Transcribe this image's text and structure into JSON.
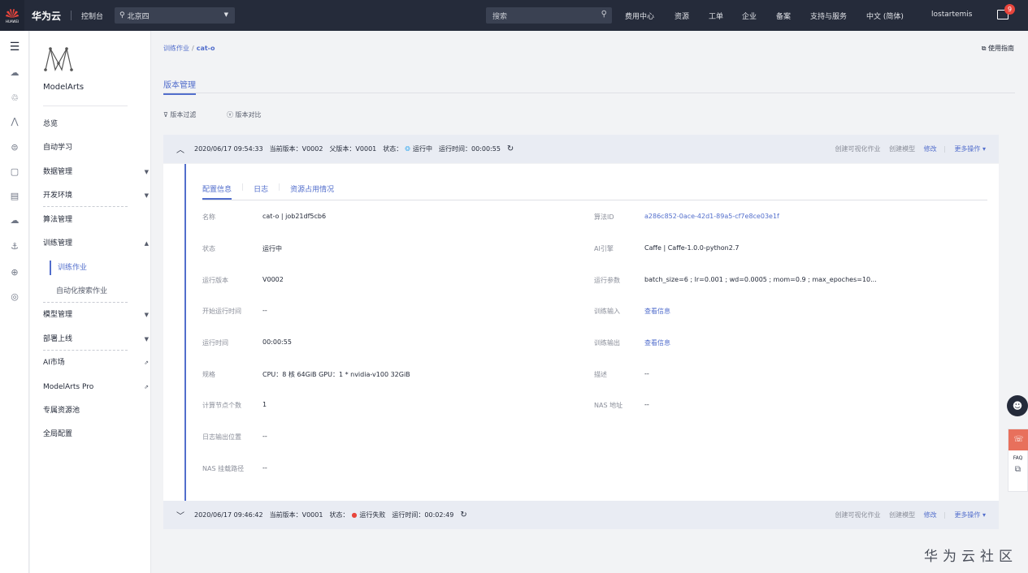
{
  "topbar": {
    "logo_text": "HUAWEI",
    "brand": "华为云",
    "console": "控制台",
    "region": "北京四",
    "search_placeholder": "搜索",
    "nav": [
      "费用中心",
      "资源",
      "工单",
      "企业",
      "备案",
      "支持与服务",
      "中文 (简体)",
      "lostartemis"
    ],
    "mail_badge": "9"
  },
  "sidebar": {
    "product": "ModelArts",
    "items": [
      {
        "label": "总览"
      },
      {
        "label": "自动学习"
      },
      {
        "label": "数据管理",
        "arrow": "▼"
      },
      {
        "label": "开发环境",
        "arrow": "▼"
      },
      {
        "label": "算法管理"
      },
      {
        "label": "训练管理",
        "arrow": "▲"
      },
      {
        "label": "训练作业",
        "sub": true,
        "active": true
      },
      {
        "label": "自动化搜索作业",
        "sub": true
      },
      {
        "label": "模型管理",
        "arrow": "▼"
      },
      {
        "label": "部署上线",
        "arrow": "▼"
      },
      {
        "label": "AI市场",
        "arrow": "⇗"
      },
      {
        "label": "ModelArts Pro",
        "arrow": "⇗"
      },
      {
        "label": "专属资源池"
      },
      {
        "label": "全局配置"
      }
    ]
  },
  "breadcrumb": {
    "parent": "训练作业",
    "current": "cat-o"
  },
  "guide": "使用指南",
  "page_tab": "版本管理",
  "toolbar": {
    "filter": "版本过滤",
    "compare": "版本对比"
  },
  "versions": [
    {
      "time": "2020/06/17 09:54:33",
      "current": "当前版本：V0002",
      "parent": "父版本：V0001",
      "status_label": "状态：",
      "status": "运行中",
      "runtime": "运行时间：00:00:55",
      "actions": [
        "创建可视化作业",
        "创建模型",
        "修改",
        "更多操作 ▾"
      ]
    },
    {
      "time": "2020/06/17 09:46:42",
      "current": "当前版本：V0001",
      "status_label": "状态：",
      "status": "运行失败",
      "runtime": "运行时间：00:02:49",
      "actions": [
        "创建可视化作业",
        "创建模型",
        "修改",
        "更多操作 ▾"
      ]
    }
  ],
  "detail": {
    "tabs": [
      "配置信息",
      "日志",
      "资源占用情况"
    ],
    "left": [
      {
        "label": "名称",
        "value": "cat-o | job21df5cb6"
      },
      {
        "label": "状态",
        "value": "运行中"
      },
      {
        "label": "运行版本",
        "value": "V0002"
      },
      {
        "label": "开始运行时间",
        "value": "--"
      },
      {
        "label": "运行时间",
        "value": "00:00:55"
      },
      {
        "label": "规格",
        "value": "CPU：8 核 64GiB GPU：1 * nvidia-v100 32GiB"
      },
      {
        "label": "计算节点个数",
        "value": "1"
      },
      {
        "label": "日志输出位置",
        "value": "--"
      },
      {
        "label": "NAS 挂载路径",
        "value": "--"
      }
    ],
    "right": [
      {
        "label": "算法ID",
        "value": "a286c852-0ace-42d1-89a5-cf7e8ce03e1f",
        "link": true
      },
      {
        "label": "AI引擎",
        "value": "Caffe | Caffe-1.0.0-python2.7"
      },
      {
        "label": "运行参数",
        "value": "batch_size=6 ; lr=0.001 ; wd=0.0005 ; mom=0.9 ; max_epoches=10..."
      },
      {
        "label": "训练输入",
        "value": "查看信息",
        "link": true
      },
      {
        "label": "训练输出",
        "value": "查看信息",
        "link": true
      },
      {
        "label": "描述",
        "value": "--"
      },
      {
        "label": "NAS 地址",
        "value": "--"
      }
    ]
  },
  "float": {
    "faq": "FAQ"
  },
  "watermark": "华为云社区"
}
